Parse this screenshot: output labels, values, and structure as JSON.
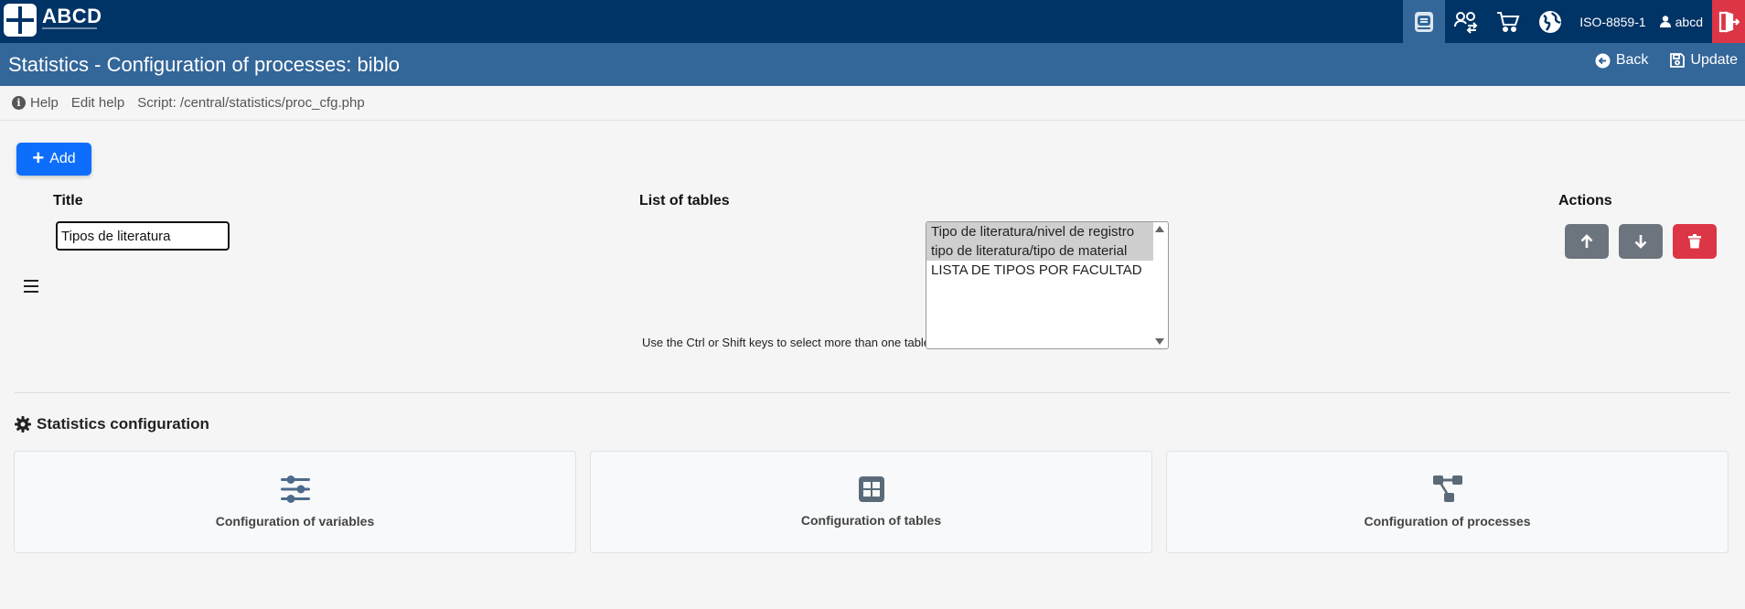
{
  "app": {
    "logo_text": "ABCD",
    "charset": "ISO-8859-1",
    "user": "abcd"
  },
  "header": {
    "title": "Statistics - Configuration of processes: biblo",
    "back_label": "Back",
    "update_label": "Update"
  },
  "helpbar": {
    "help_label": "Help",
    "edit_help_label": "Edit help",
    "script_label": "Script: /central/statistics/proc_cfg.php"
  },
  "form": {
    "add_label": "Add",
    "col_title": "Title",
    "col_tables": "List of tables",
    "col_actions": "Actions",
    "title_value": "Tipos de literatura",
    "hint": "Use the Ctrl or Shift keys to select more than one table",
    "table_options": [
      {
        "label": "Tipo de literatura/nivel de registro",
        "selected": true
      },
      {
        "label": "tipo de literatura/tipo de material",
        "selected": true
      },
      {
        "label": "LISTA DE TIPOS POR FACULTAD",
        "selected": false
      }
    ]
  },
  "stats_config": {
    "title": "Statistics configuration",
    "cards": [
      {
        "label": "Configuration of variables",
        "icon": "sliders-icon"
      },
      {
        "label": "Configuration of tables",
        "icon": "table-icon"
      },
      {
        "label": "Configuration of processes",
        "icon": "diagram-icon"
      }
    ]
  },
  "colors": {
    "topbar": "#003366",
    "titlebar": "#336699",
    "primary": "#0d6efd",
    "danger": "#dc3545",
    "secondary": "#6c757d",
    "icon_slate": "#4d6a8a"
  }
}
